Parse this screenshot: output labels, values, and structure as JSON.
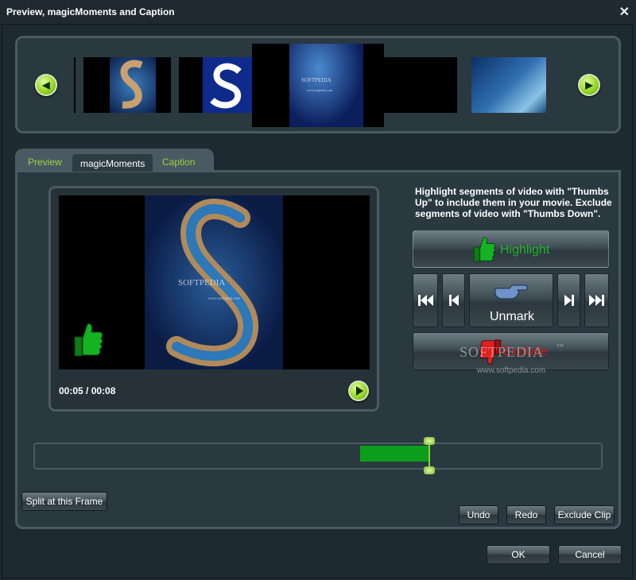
{
  "window": {
    "title": "Preview, magicMoments and Caption",
    "close_glyph": "✕"
  },
  "filmstrip": {
    "prev_glyph": "◀",
    "next_glyph": "▶",
    "frame_logo": "SOFTPEDIA",
    "frame_site": "www.softpedia.com"
  },
  "tabs": [
    {
      "label": "Preview"
    },
    {
      "label": "magicMoments"
    },
    {
      "label": "Caption"
    }
  ],
  "player": {
    "timecode": "00:05 / 00:08",
    "logo": "SOFTPEDIA",
    "site": "www.softpedia.com"
  },
  "panel": {
    "instructions": "Highlight segments of video with \"Thumbs Up\" to include them in your movie. Exclude segments of video with \"Thumbs Down\".",
    "highlight_label": "Highlight",
    "unmark_label": "Unmark",
    "exclude_label": "Exclude",
    "watermark": "SOFTPEDIA",
    "watermark_tm": "™",
    "watermark_site": "www.softpedia.com"
  },
  "timeline": {
    "segment_start": 0.574,
    "segment_end": 0.697,
    "playhead": 0.696
  },
  "buttons": {
    "split": "Split at this Frame",
    "undo": "Undo",
    "redo": "Redo",
    "exclude_clip": "Exclude Clip",
    "ok": "OK",
    "cancel": "Cancel"
  },
  "colors": {
    "accent_green": "#9ed13a",
    "highlight_green": "#0a9e1a",
    "exclude_red": "#d01818",
    "panel_border": "#4a5a63"
  }
}
